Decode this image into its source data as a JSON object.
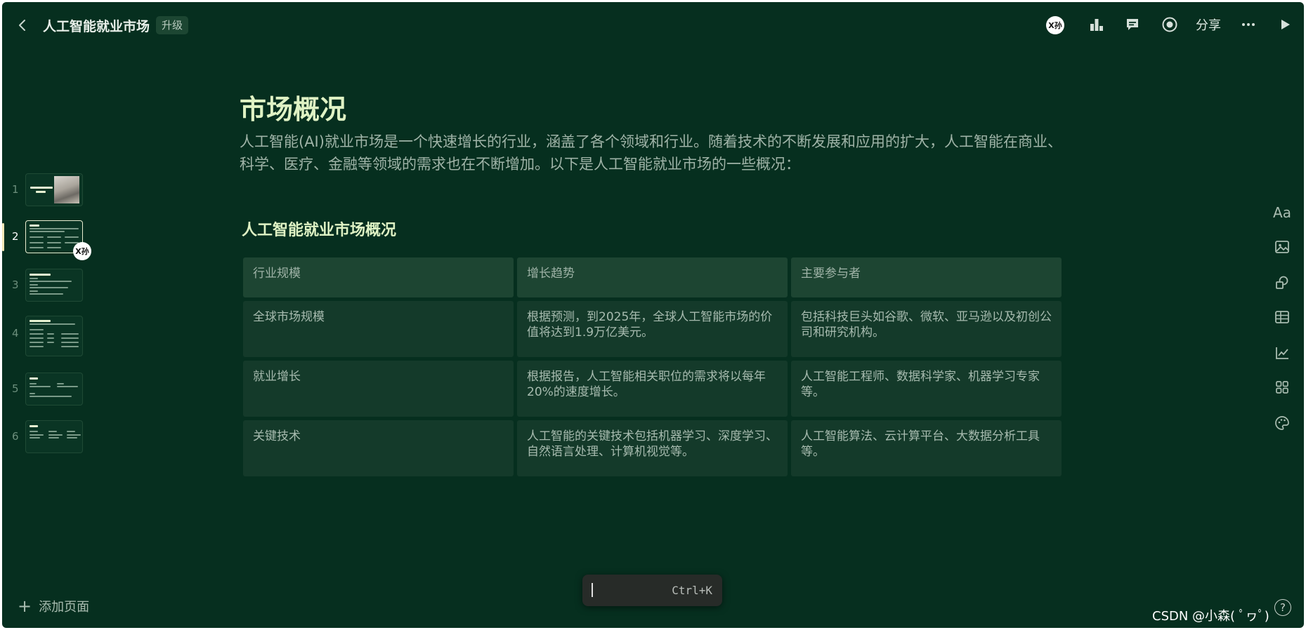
{
  "header": {
    "title": "人工智能就业市场",
    "upgrade_label": "升级",
    "avatar_text": "X孙",
    "share_label": "分享"
  },
  "sidebar": {
    "slides": [
      {
        "number": "1"
      },
      {
        "number": "2",
        "active": true
      },
      {
        "number": "3"
      },
      {
        "number": "4"
      },
      {
        "number": "5"
      },
      {
        "number": "6"
      }
    ],
    "collaborator_avatar": "X孙",
    "add_page_label": "添加页面"
  },
  "slide": {
    "title": "市场概况",
    "description": "人工智能(AI)就业市场是一个快速增长的行业，涵盖了各个领域和行业。随着技术的不断发展和应用的扩大，人工智能在商业、科学、医疗、金融等领域的需求也在不断增加。以下是人工智能就业市场的一些概况：",
    "section_title": "人工智能就业市场概况",
    "table": {
      "headers": [
        "行业规模",
        "增长趋势",
        "主要参与者"
      ],
      "rows": [
        [
          "全球市场规模",
          "根据预测，到2025年，全球人工智能市场的价值将达到1.9万亿美元。",
          "包括科技巨头如谷歌、微软、亚马逊以及初创公司和研究机构。"
        ],
        [
          "就业增长",
          "根据报告，人工智能相关职位的需求将以每年20%的速度增长。",
          "人工智能工程师、数据科学家、机器学习专家等。"
        ],
        [
          "关键技术",
          "人工智能的关键技术包括机器学习、深度学习、自然语言处理、计算机视觉等。",
          "人工智能算法、云计算平台、大数据分析工具等。"
        ]
      ]
    }
  },
  "right_toolbar": {
    "text_label": "Aa"
  },
  "command_bar": {
    "shortcut": "Ctrl+K"
  },
  "watermark": "CSDN @小森( ﾟヮﾟ)",
  "help_label": "?"
}
